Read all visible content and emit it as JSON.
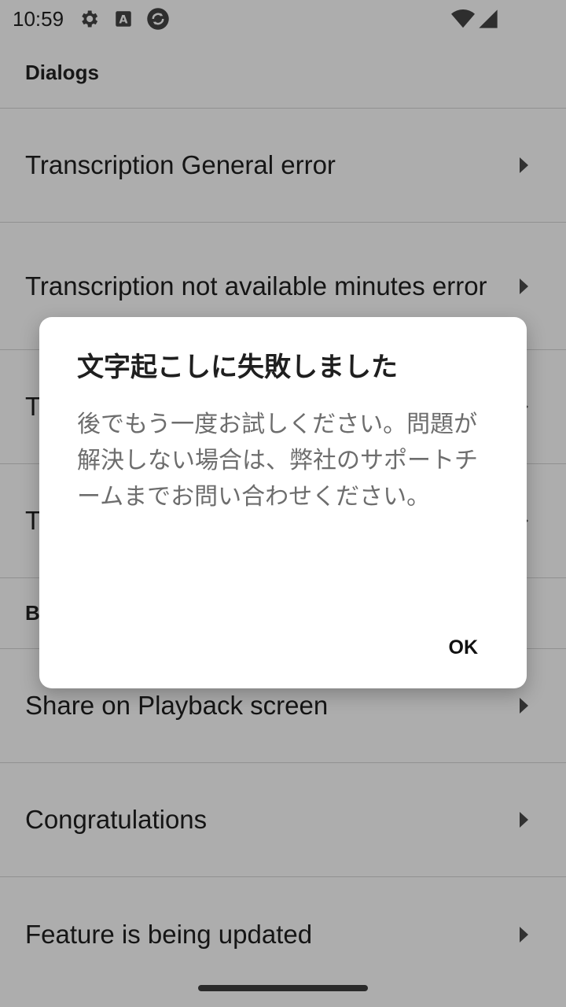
{
  "status_bar": {
    "time": "10:59",
    "icons": [
      "gear-icon",
      "a-badge-icon",
      "sync-icon",
      "wifi-icon",
      "cell-signal-icon"
    ]
  },
  "list": {
    "section_dialogs": "Dialogs",
    "items_top": [
      {
        "label": "Transcription General error"
      },
      {
        "label": "Transcription not available minutes error"
      },
      {
        "label": "T"
      },
      {
        "label": "T"
      }
    ],
    "section_b": "B",
    "items_bottom": [
      {
        "label": "Share on Playback screen"
      },
      {
        "label": "Congratulations"
      },
      {
        "label": "Feature is being updated"
      }
    ]
  },
  "dialog": {
    "title": "文字起こしに失敗しました",
    "message": "後でもう一度お試しください。問題が解決しない場合は、弊社のサポートチームまでお問い合わせください。",
    "ok_label": "OK"
  },
  "colors": {
    "scrim": "#000000",
    "dialog_bg": "#ffffff",
    "message_text": "#6d6d6d"
  }
}
